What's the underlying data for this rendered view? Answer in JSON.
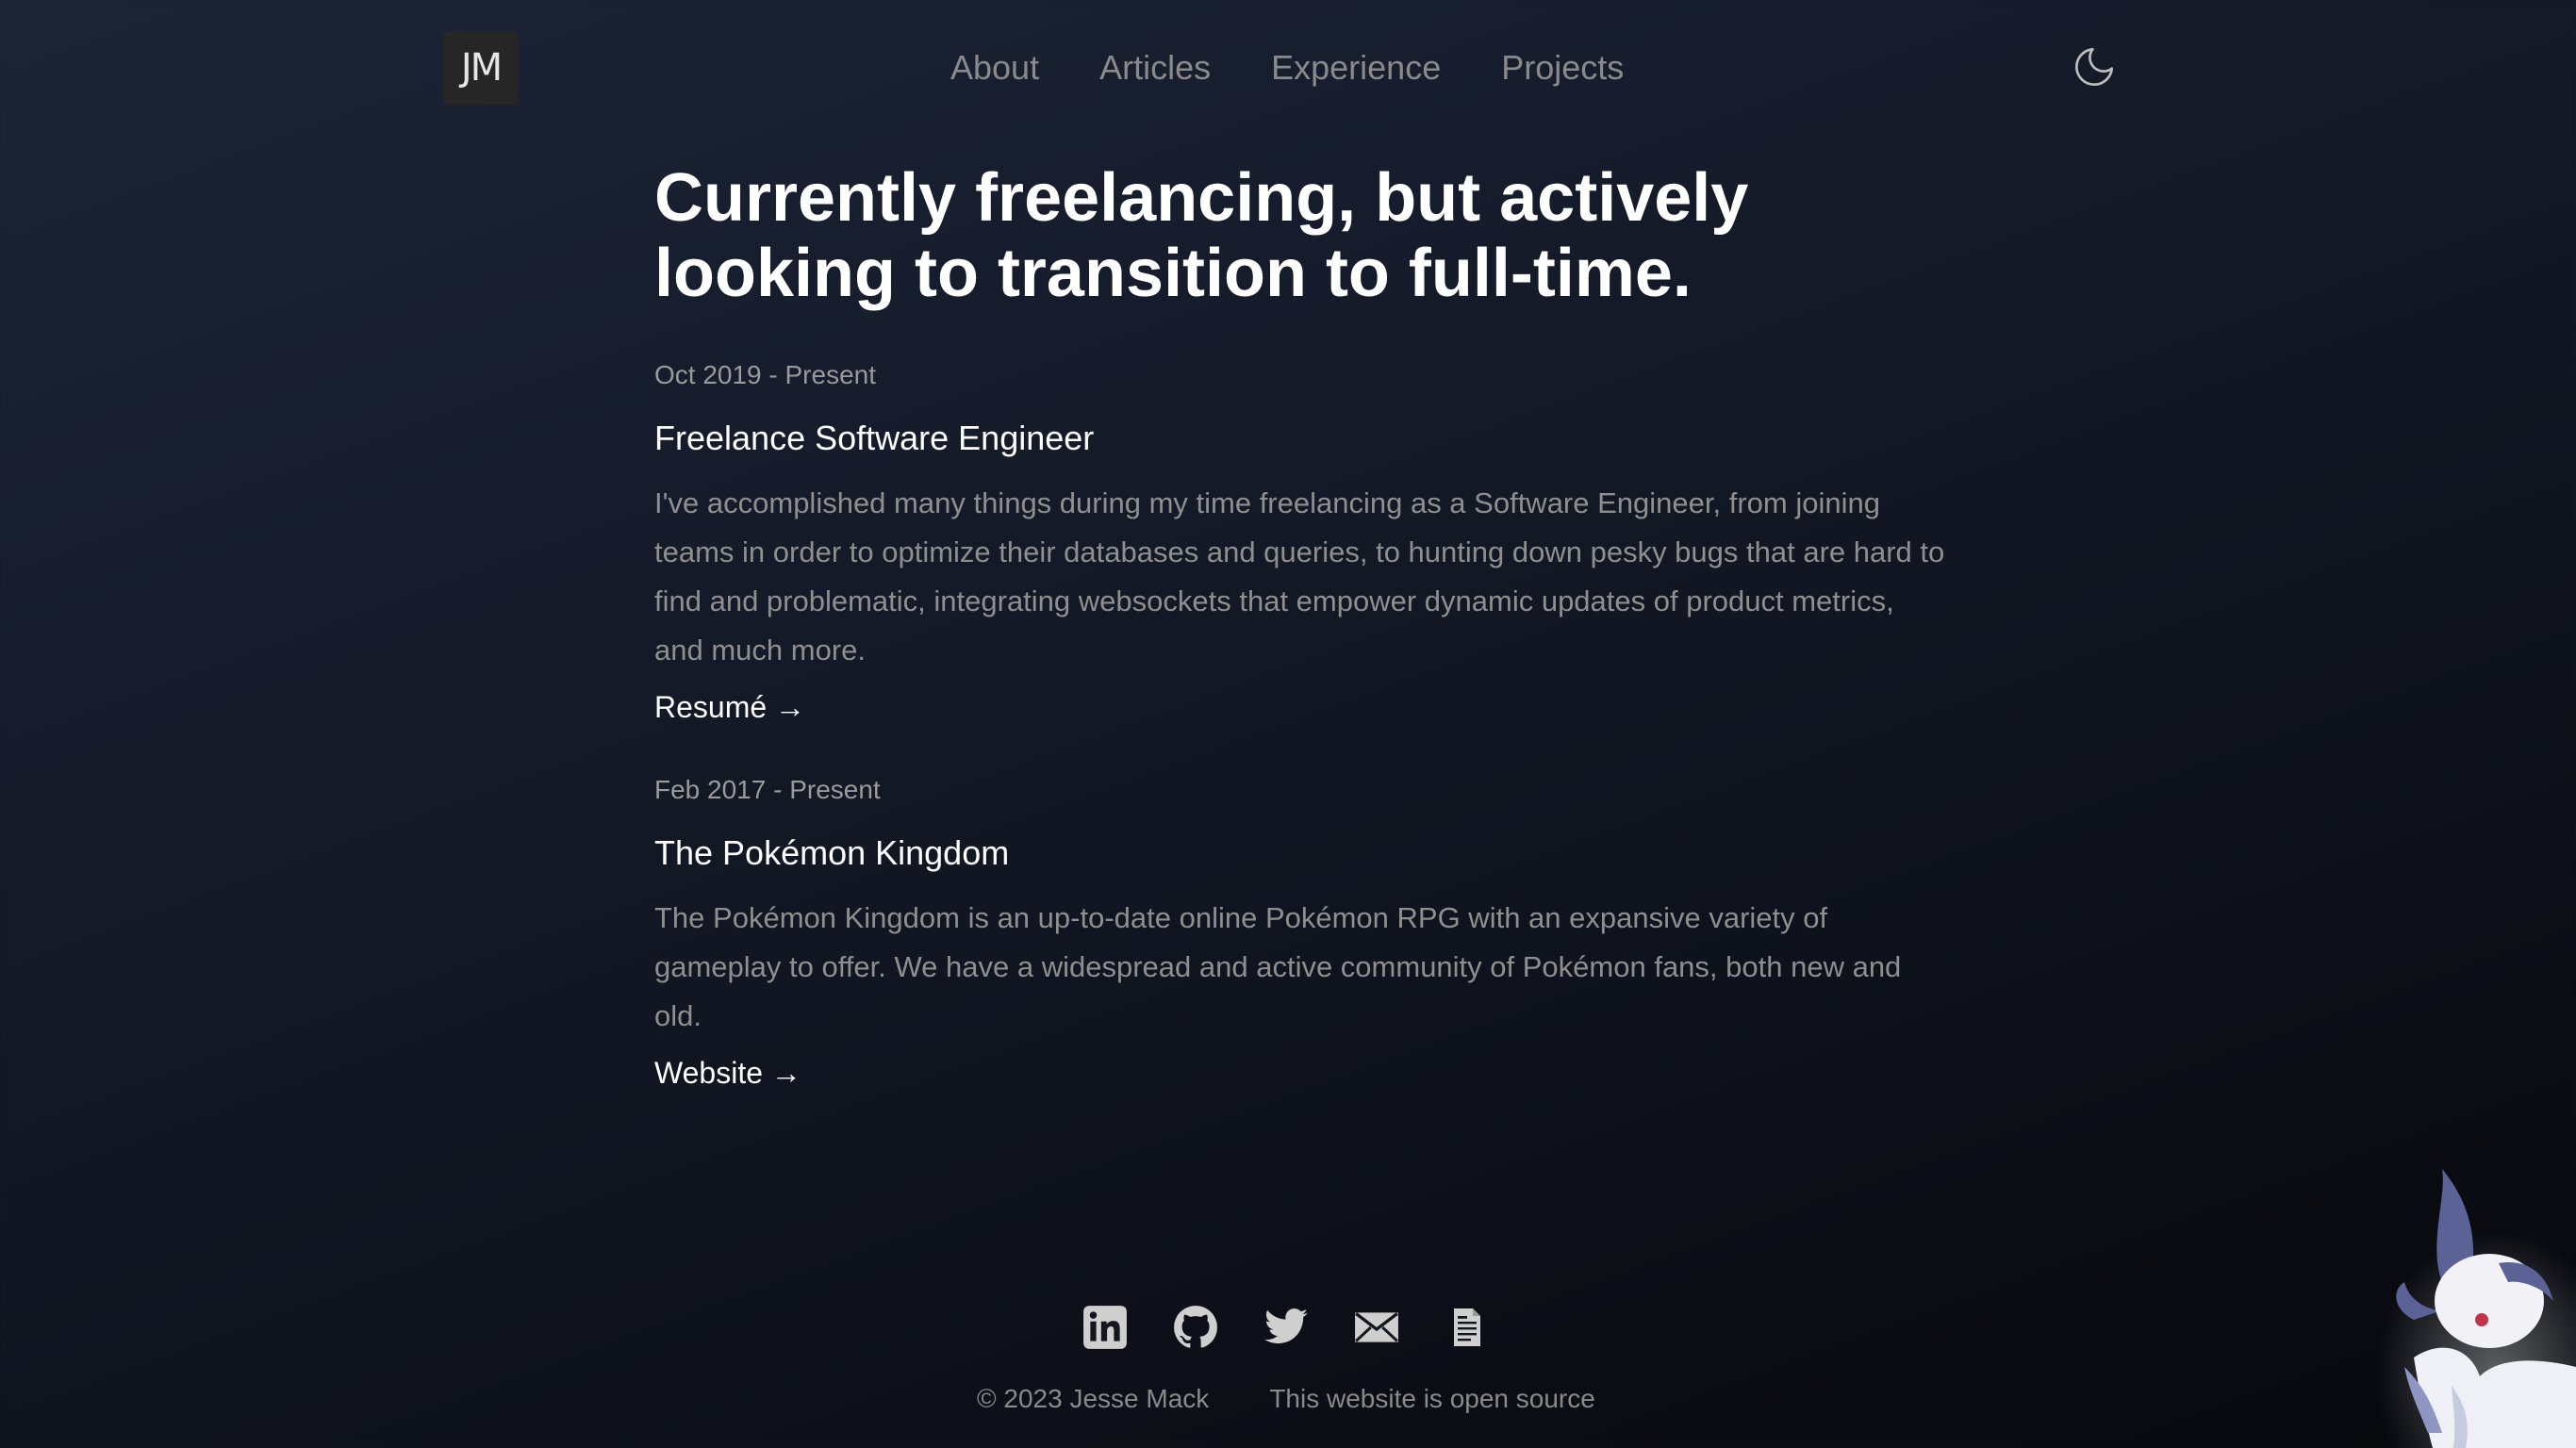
{
  "header": {
    "logo_text": "JM",
    "nav": [
      "About",
      "Articles",
      "Experience",
      "Projects"
    ],
    "theme_toggle_icon": "moon-icon"
  },
  "main": {
    "headline": "Currently freelancing, but actively looking to transition to full-time.",
    "entries": [
      {
        "date": "Oct 2019 - Present",
        "title": "Freelance Software Engineer",
        "description": "I've accomplished many things during my time freelancing as a Software Engineer, from joining teams in order to optimize their databases and queries, to hunting down pesky bugs that are hard to find and problematic, integrating websockets that empower dynamic updates of product metrics, and much more.",
        "link_label": "Resumé →"
      },
      {
        "date": "Feb 2017 - Present",
        "title": "The Pokémon Kingdom",
        "description": "The Pokémon Kingdom is an up-to-date online Pokémon RPG with an expansive variety of gameplay to offer. We have a widespread and active community of Pokémon fans, both new and old.",
        "link_label": "Website →"
      }
    ]
  },
  "social": {
    "icons": [
      "linkedin-icon",
      "github-icon",
      "twitter-icon",
      "email-icon",
      "resume-icon"
    ]
  },
  "footer": {
    "copyright": "© 2023 Jesse Mack",
    "source_link": "This website is open source"
  },
  "colors": {
    "text": "#ffffff",
    "muted": "#8f8f8f",
    "nav": "#8a8a8a",
    "logo_bg": "#262626"
  }
}
